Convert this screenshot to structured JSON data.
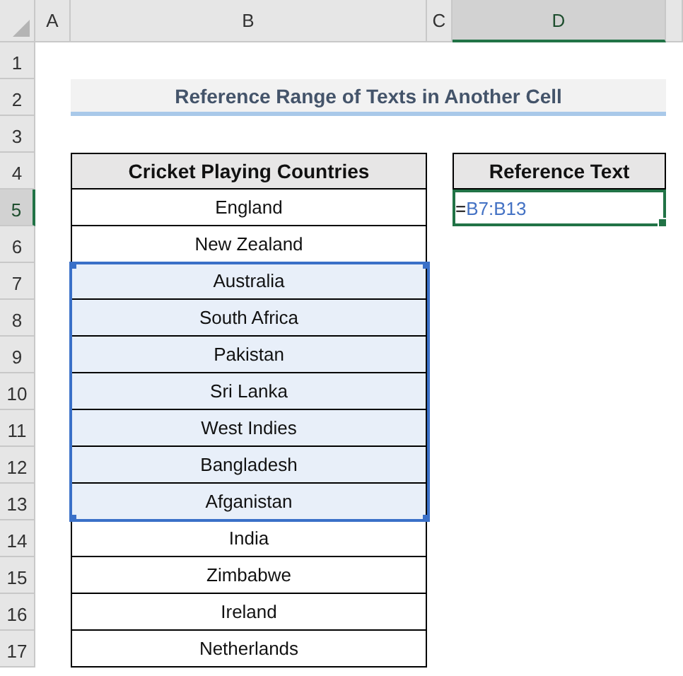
{
  "columns": [
    {
      "label": "A",
      "selected": false
    },
    {
      "label": "B",
      "selected": false
    },
    {
      "label": "C",
      "selected": false
    },
    {
      "label": "D",
      "selected": true
    }
  ],
  "rows": [
    {
      "label": "1",
      "selected": false
    },
    {
      "label": "2",
      "selected": false
    },
    {
      "label": "3",
      "selected": false
    },
    {
      "label": "4",
      "selected": false
    },
    {
      "label": "5",
      "selected": true
    },
    {
      "label": "6",
      "selected": false
    },
    {
      "label": "7",
      "selected": false
    },
    {
      "label": "8",
      "selected": false
    },
    {
      "label": "9",
      "selected": false
    },
    {
      "label": "10",
      "selected": false
    },
    {
      "label": "11",
      "selected": false
    },
    {
      "label": "12",
      "selected": false
    },
    {
      "label": "13",
      "selected": false
    },
    {
      "label": "14",
      "selected": false
    },
    {
      "label": "15",
      "selected": false
    },
    {
      "label": "16",
      "selected": false
    },
    {
      "label": "17",
      "selected": false
    }
  ],
  "title": "Reference Range of Texts in Another Cell",
  "table": {
    "header": "Cricket Playing Countries",
    "cells": [
      {
        "text": "England",
        "selected": false
      },
      {
        "text": "New Zealand",
        "selected": false
      },
      {
        "text": "Australia",
        "selected": true
      },
      {
        "text": "South Africa",
        "selected": true
      },
      {
        "text": "Pakistan",
        "selected": true
      },
      {
        "text": "Sri Lanka",
        "selected": true
      },
      {
        "text": "West Indies",
        "selected": true
      },
      {
        "text": "Bangladesh",
        "selected": true
      },
      {
        "text": "Afganistan",
        "selected": true
      },
      {
        "text": "India",
        "selected": false
      },
      {
        "text": "Zimbabwe",
        "selected": false
      },
      {
        "text": "Ireland",
        "selected": false
      },
      {
        "text": "Netherlands",
        "selected": false
      }
    ]
  },
  "reference": {
    "header": "Reference Text",
    "formula_operator": "=",
    "formula_range": "B7:B13"
  }
}
